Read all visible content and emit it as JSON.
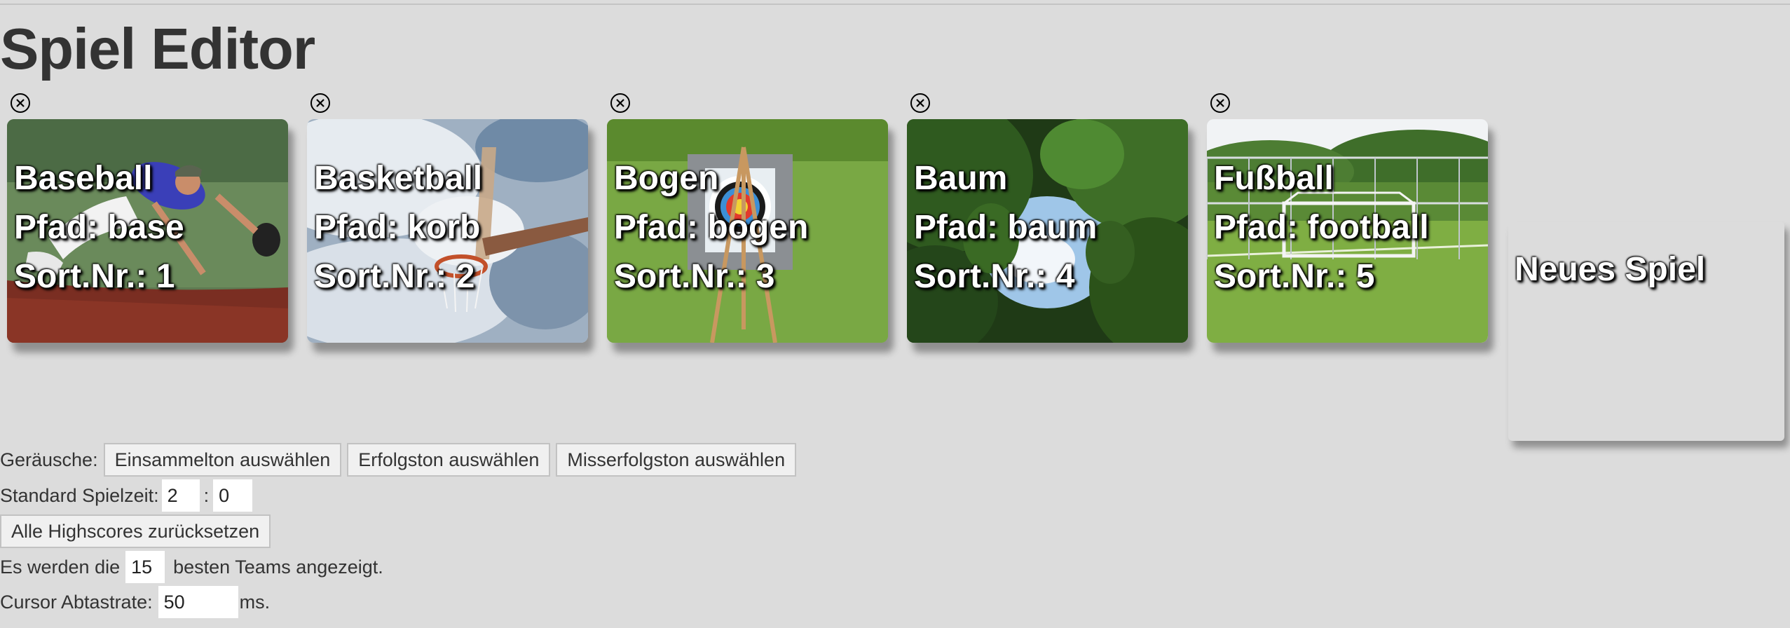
{
  "header": {
    "title": "Spiel Editor"
  },
  "games": [
    {
      "name": "Baseball",
      "path": "Pfad: base",
      "sort": "Sort.Nr.: 1",
      "image": "baseball-player-diving"
    },
    {
      "name": "Basketball",
      "path": "Pfad: korb",
      "sort": "Sort.Nr.: 2",
      "image": "basketball-hoop-sky"
    },
    {
      "name": "Bogen",
      "path": "Pfad: bogen",
      "sort": "Sort.Nr.: 3",
      "image": "archery-target-field"
    },
    {
      "name": "Baum",
      "path": "Pfad: baum",
      "sort": "Sort.Nr.: 4",
      "image": "trees-canopy"
    },
    {
      "name": "Fußball",
      "path": "Pfad: football",
      "sort": "Sort.Nr.: 5",
      "image": "football-goal-field"
    }
  ],
  "new_game": {
    "label": "Neues Spiel"
  },
  "icons": {
    "delete": "close-circle-icon"
  },
  "settings": {
    "sounds": {
      "label": "Geräusche:",
      "collect_button": "Einsammelton auswählen",
      "success_button": "Erfolgston auswählen",
      "failure_button": "Misserfolgston auswählen"
    },
    "game_time": {
      "label": "Standard Spielzeit:",
      "minutes": "2",
      "separator": ":",
      "seconds": "0"
    },
    "reset_highscores_button": "Alle Highscores zurücksetzen",
    "teams": {
      "prefix": "Es werden die",
      "count": "15",
      "suffix": "besten Teams angezeigt."
    },
    "cursor": {
      "label": "Cursor Abtastrate:",
      "value": "50",
      "unit": "ms."
    }
  },
  "colors": {
    "background": "#dcdcdc",
    "text": "#333333",
    "card_text": "#ffffff"
  }
}
